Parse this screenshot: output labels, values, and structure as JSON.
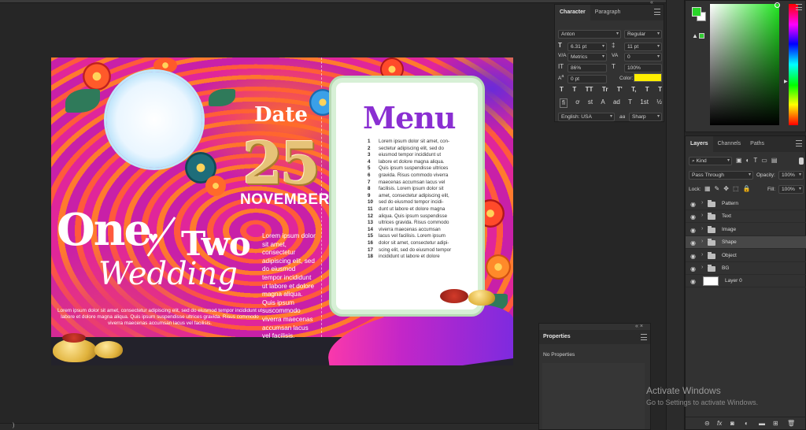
{
  "artboard": {
    "date_label": "Date",
    "date_number": "25",
    "date_month": "NOVEMBER",
    "title_one": "One",
    "title_two": "Two",
    "title_wedding": "Wedding",
    "side_text": "Lorem ipsum dolor sit amet, consectetur adipiscing elit, sed do eiusmod tempor incididunt ut labore et dolore magna aliqua. Quis ipsum suscommodo viverra maecenas accumsan lacus vel facilisis.",
    "bottom_text": "Lorem ipsum dolor sit amet, consectetur adipiscing elit, sed do eiusmod tempor incididunt ut labore et dolore magna aliqua. Quis ipsum suspendisse ultrices gravida. Risus commodo viverra maecenas accumsan lacus vel facilisis.",
    "menu_title": "Menu",
    "menu_items": [
      {
        "n": "1",
        "text": "Lorem ipsum dolor sit amet, con-"
      },
      {
        "n": "2",
        "text": "sectetur adipiscing elit, sed do"
      },
      {
        "n": "3",
        "text": "eiusmod tempor incididunt ut"
      },
      {
        "n": "4",
        "text": "labore et dolore magna aliqua."
      },
      {
        "n": "5",
        "text": "Quis ipsum suspendisse ultrices"
      },
      {
        "n": "6",
        "text": "gravida. Risus commodo viverra"
      },
      {
        "n": "7",
        "text": "maecenas accumsan lacus vel"
      },
      {
        "n": "8",
        "text": "facilisis. Lorem ipsum dolor sit"
      },
      {
        "n": "9",
        "text": "amet, consectetur adipiscing elit,"
      },
      {
        "n": "10",
        "text": "sed do eiusmod tempor incidi-"
      },
      {
        "n": "11",
        "text": "dunt ut labore et dolore magna"
      },
      {
        "n": "12",
        "text": "aliqua. Quis ipsum suspendisse"
      },
      {
        "n": "13",
        "text": "ultrices gravida. Risus commodo"
      },
      {
        "n": "14",
        "text": "viverra maecenas accumsan"
      },
      {
        "n": "15",
        "text": "lacus vel facilisis. Lorem ipsum"
      },
      {
        "n": "16",
        "text": "dolor sit amet, consectetur adipi-"
      },
      {
        "n": "17",
        "text": "scing elit, sed do eiusmod tempor"
      },
      {
        "n": "18",
        "text": "incididunt ut labore et dolore"
      }
    ]
  },
  "character": {
    "tabs": [
      "Character",
      "Paragraph"
    ],
    "font_family": "Anton",
    "font_style": "Regular",
    "font_size": "6.31 pt",
    "leading": "11 pt",
    "kerning": "Metrics",
    "tracking": "0",
    "vertical_scale": "86%",
    "horizontal_scale": "100%",
    "baseline_shift": "0 pt",
    "color_label": "Color:",
    "color_value": "#ffee00",
    "type_buttons": [
      "T",
      "T",
      "TT",
      "Tr",
      "T'",
      "T,",
      "T",
      "T"
    ],
    "opentype_buttons": [
      "fi",
      "ơ",
      "st",
      "A",
      "ad",
      "T",
      "1st",
      "½"
    ],
    "language": "English: USA",
    "antialias_glyph": "aa",
    "antialias": "Sharp"
  },
  "color_panel": {
    "foreground": "#2ad62a",
    "background": "#ffffff"
  },
  "layers": {
    "tabs": [
      "Layers",
      "Channels",
      "Paths"
    ],
    "filter_kind": "Kind",
    "blend_mode": "Pass Through",
    "opacity_label": "Opacity:",
    "opacity_value": "100%",
    "lock_label": "Lock:",
    "fill_label": "Fill:",
    "fill_value": "100%",
    "items": [
      {
        "name": "Pattern",
        "type": "folder"
      },
      {
        "name": "Text",
        "type": "folder"
      },
      {
        "name": "Image",
        "type": "folder"
      },
      {
        "name": "Shape",
        "type": "folder",
        "selected": true
      },
      {
        "name": "Object",
        "type": "folder"
      },
      {
        "name": "BG",
        "type": "folder"
      },
      {
        "name": "Layer 0",
        "type": "pixel"
      }
    ]
  },
  "properties": {
    "title": "Properties",
    "content": "No Properties"
  },
  "watermark": {
    "line1": "Activate Windows",
    "line2": "Go to Settings to activate Windows."
  },
  "bottom_bar": {
    "left_glyph": ")"
  }
}
